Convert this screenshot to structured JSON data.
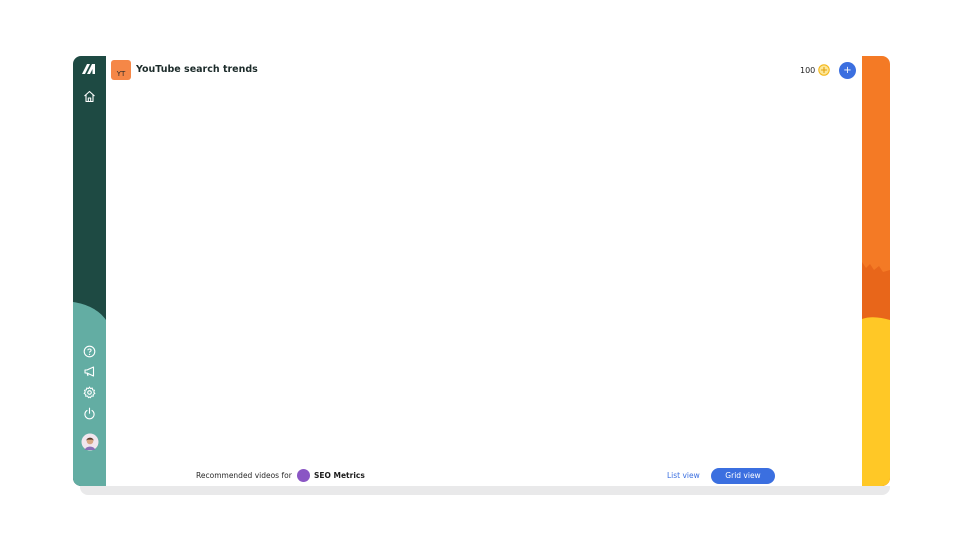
{
  "header": {
    "badge_text": "YT",
    "title": "YouTube search trends",
    "credits": "100",
    "add_label": "+"
  },
  "sidebar": {
    "logo_icon": "brand-logo-icon",
    "items": [
      {
        "name": "home",
        "icon": "home-icon"
      },
      {
        "name": "help",
        "icon": "help-circle-icon"
      },
      {
        "name": "announcements",
        "icon": "megaphone-icon"
      },
      {
        "name": "settings",
        "icon": "gear-icon"
      },
      {
        "name": "logout",
        "icon": "power-icon"
      },
      {
        "name": "profile",
        "icon": "avatar-icon"
      }
    ]
  },
  "footer": {
    "recommended_label": "Recommended videos for",
    "channel_name": "SEO Metrics",
    "list_view_label": "List view",
    "grid_view_label": "Grid view"
  },
  "colors": {
    "sidebar_dark": "#1e4a43",
    "sidebar_light": "#63ada3",
    "accent_blue": "#3b6fe0",
    "coin_yellow": "#f4b81c",
    "deco_orange": "#f47a25",
    "deco_orange_dark": "#e8661a",
    "deco_yellow": "#ffc826",
    "channel_purple": "#8a56c4",
    "badge_orange": "#f58747"
  }
}
